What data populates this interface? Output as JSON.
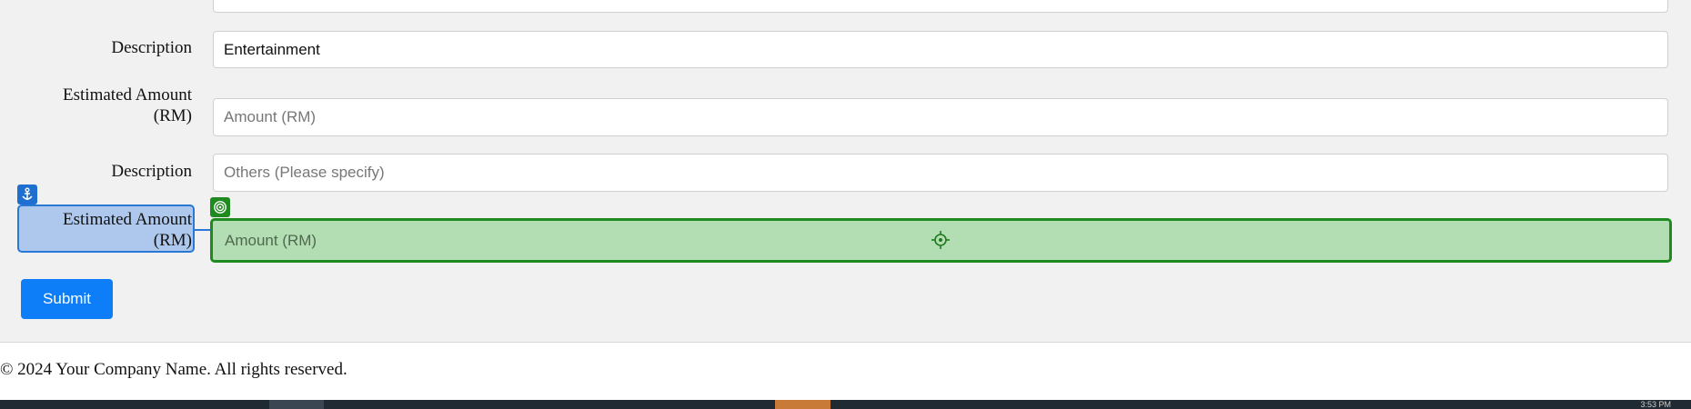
{
  "form": {
    "rows": [
      {
        "label": "Description",
        "value": "Entertainment",
        "placeholder": ""
      },
      {
        "label": "Estimated Amount (RM)",
        "value": "",
        "placeholder": "Amount (RM)"
      },
      {
        "label": "Description",
        "value": "",
        "placeholder": "Others (Please specify)"
      },
      {
        "label": "Estimated Amount (RM)",
        "value": "",
        "placeholder": "Amount (RM)"
      }
    ],
    "labels": {
      "amount_line1": "Estimated Amount",
      "amount_line2": "(RM)"
    },
    "submit_label": "Submit"
  },
  "footer": {
    "text": "© 2024 Your Company Name. All rights reserved."
  },
  "taskbar": {
    "clock": "3:53 PM"
  },
  "colors": {
    "submit_bg": "#0d7ef7",
    "anchor_highlight": "#2a78d6",
    "target_highlight": "#1f8a1f"
  }
}
